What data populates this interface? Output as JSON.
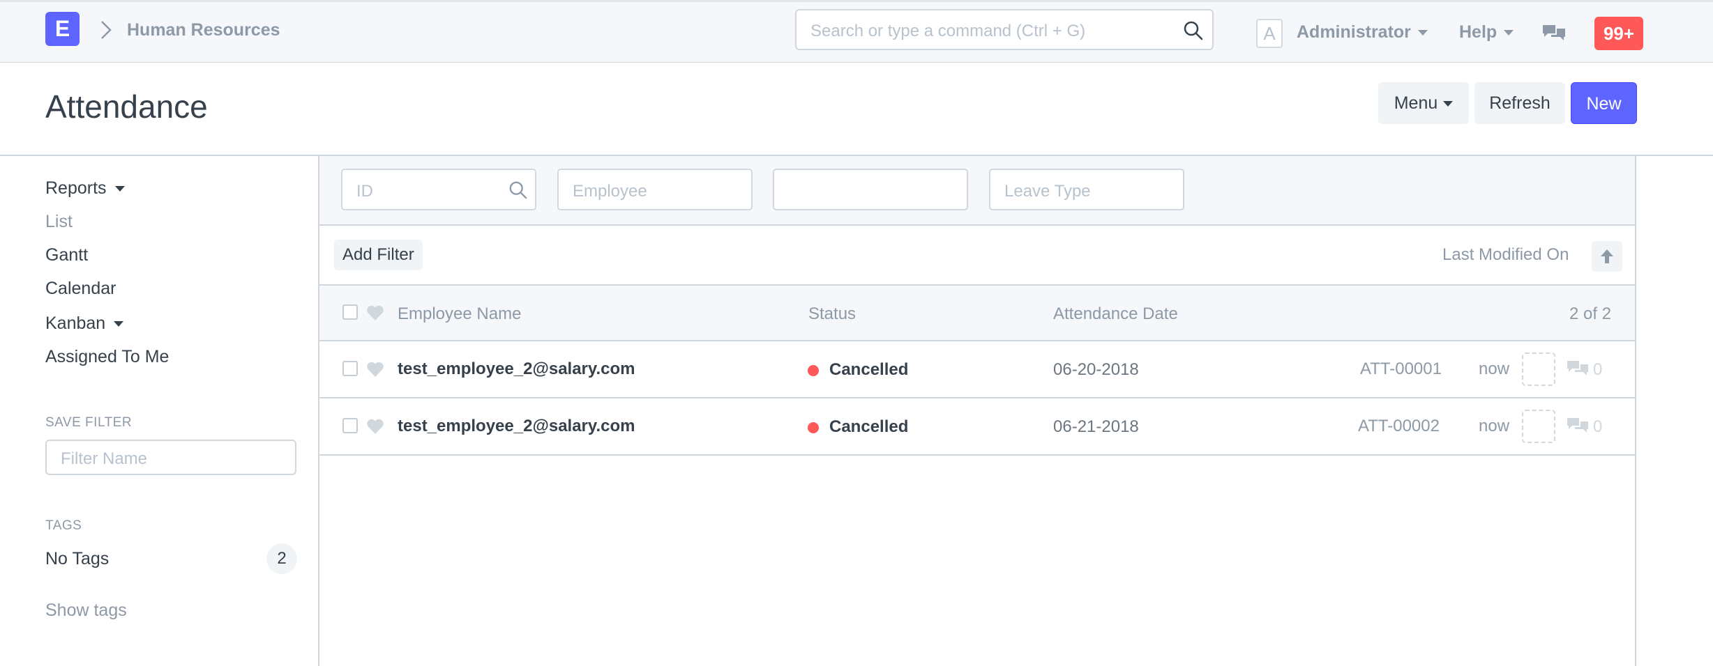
{
  "navbar": {
    "logo_letter": "E",
    "breadcrumb": "Human Resources",
    "search_placeholder": "Search or type a command (Ctrl + G)",
    "avatar_letter": "A",
    "user": "Administrator",
    "help": "Help",
    "notifications_badge": "99+"
  },
  "page": {
    "title": "Attendance",
    "menu_label": "Menu",
    "refresh_label": "Refresh",
    "new_label": "New"
  },
  "sidebar": {
    "items": [
      "Reports",
      "List",
      "Gantt",
      "Calendar",
      "Kanban",
      "Assigned To Me"
    ],
    "save_filter_label": "SAVE FILTER",
    "filter_name_placeholder": "Filter Name",
    "tags_label": "TAGS",
    "no_tags_label": "No Tags",
    "no_tags_count": "2",
    "show_tags_label": "Show tags"
  },
  "filters": {
    "id_placeholder": "ID",
    "employee_placeholder": "Employee",
    "third_placeholder": "",
    "leave_type_placeholder": "Leave Type",
    "add_filter_label": "Add Filter",
    "sort_label": "Last Modified On"
  },
  "list": {
    "columns": [
      "Employee Name",
      "Status",
      "Attendance Date"
    ],
    "count_text": "2 of 2",
    "rows": [
      {
        "employee": "test_employee_2@salary.com",
        "status": "Cancelled",
        "date": "06-20-2018",
        "id": "ATT-00001",
        "modified": "now",
        "comments": "0"
      },
      {
        "employee": "test_employee_2@salary.com",
        "status": "Cancelled",
        "date": "06-21-2018",
        "id": "ATT-00002",
        "modified": "now",
        "comments": "0"
      }
    ]
  },
  "colors": {
    "primary": "#5e64ff",
    "danger": "#ff5858",
    "muted": "#8d99a6",
    "text": "#36414c",
    "border": "#d1d8dd"
  },
  "icons": {
    "search": "search-icon",
    "breadcrumb_separator": "chevron-right-icon",
    "chat": "chat-icon",
    "heart": "heart-icon",
    "sort": "arrow-up-icon",
    "comment": "comment-icon"
  }
}
